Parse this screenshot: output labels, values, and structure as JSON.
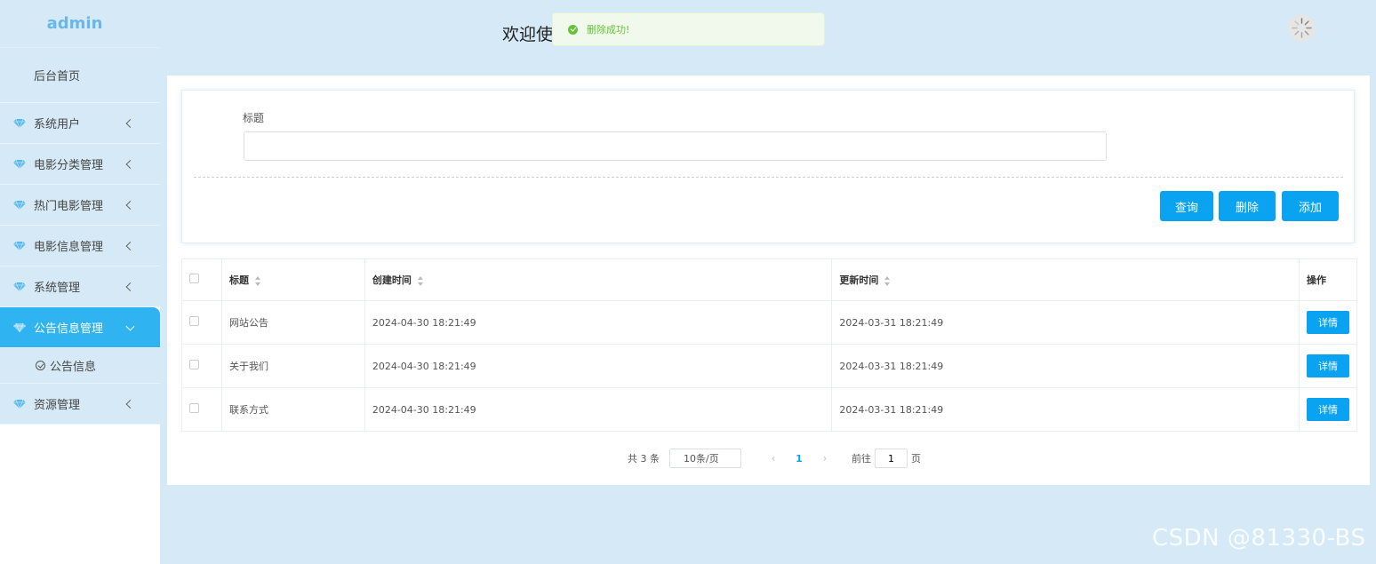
{
  "sidebar": {
    "logo": "admin",
    "home": "后台首页",
    "items": [
      {
        "label": "系统用户"
      },
      {
        "label": "电影分类管理"
      },
      {
        "label": "热门电影管理"
      },
      {
        "label": "电影信息管理"
      },
      {
        "label": "系统管理"
      },
      {
        "label": "公告信息管理",
        "active": true
      },
      {
        "label": "资源管理"
      }
    ],
    "active_sub": "公告信息"
  },
  "header": {
    "welcome": "欢迎使",
    "toast": "删除成功!"
  },
  "search": {
    "title_label": "标题",
    "title_value": "",
    "query_button": "查询",
    "delete_button": "删除",
    "add_button": "添加"
  },
  "table": {
    "columns": [
      "标题",
      "创建时间",
      "更新时间",
      "操作"
    ],
    "rows": [
      {
        "title": "网站公告",
        "created": "2024-04-30 18:21:49",
        "updated": "2024-03-31 18:21:49",
        "action": "详情"
      },
      {
        "title": "关于我们",
        "created": "2024-04-30 18:21:49",
        "updated": "2024-03-31 18:21:49",
        "action": "详情"
      },
      {
        "title": "联系方式",
        "created": "2024-04-30 18:21:49",
        "updated": "2024-03-31 18:21:49",
        "action": "详情"
      }
    ]
  },
  "pager": {
    "total": "共 3 条",
    "page_size": "10条/页",
    "current_page": "1",
    "goto_label": "前往",
    "goto_value": "1",
    "page_suffix": "页"
  },
  "watermark": "CSDN @81330-BS",
  "colors": {
    "primary": "#0aa3f2",
    "sidebar_active": "#2fb3f1",
    "background": "#d6e9f6",
    "success": "#67c23a"
  }
}
